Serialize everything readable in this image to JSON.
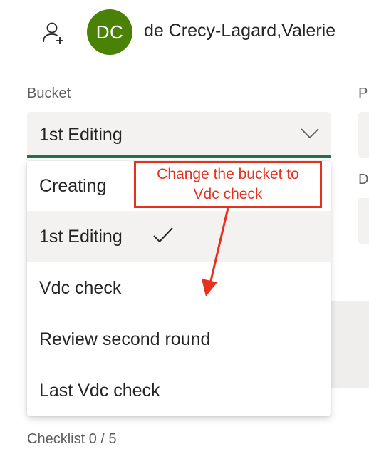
{
  "header": {
    "avatar_initials": "DC",
    "user_name": "de Crecy-Lagard,Valerie",
    "avatar_color": "#498205"
  },
  "side_labels": {
    "top": "P",
    "second": "D"
  },
  "bucket": {
    "label": "Bucket",
    "value": "1st Editing",
    "underline_color": "#217346"
  },
  "menu": {
    "items": [
      {
        "label": "Creating",
        "selected": false
      },
      {
        "label": "1st Editing",
        "selected": true
      },
      {
        "label": "Vdc check",
        "selected": false
      },
      {
        "label": "Review second round",
        "selected": false
      },
      {
        "label": "Last Vdc check",
        "selected": false
      }
    ]
  },
  "annotation": {
    "line1": "Change the bucket to",
    "line2": "Vdc check",
    "color": "#e8301e"
  },
  "checklist": {
    "label": "Checklist 0 / 5"
  },
  "icons": {
    "add_person": "add-person-icon",
    "dropdown": "chevron-down-icon",
    "selected": "checkmark-icon"
  }
}
